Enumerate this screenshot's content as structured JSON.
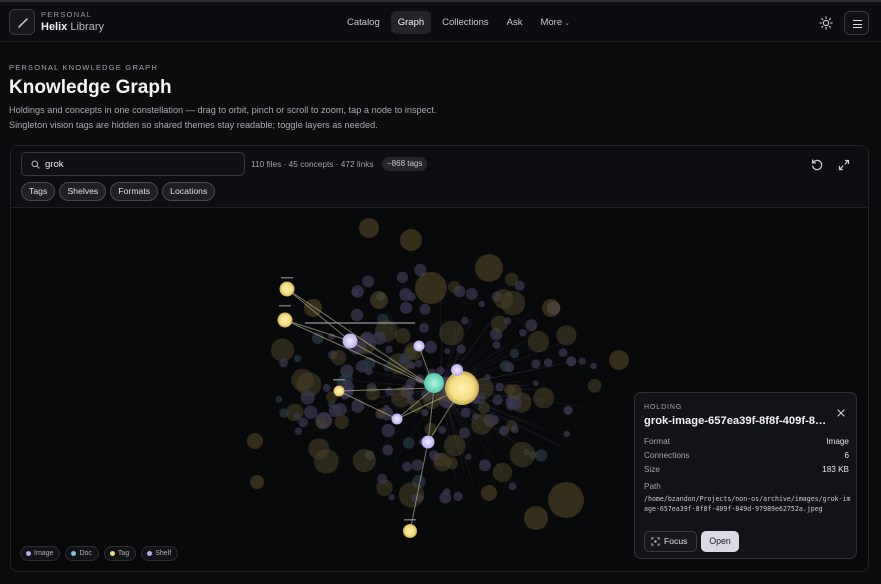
{
  "header": {
    "brand_sup": "PERSONAL",
    "brand_bold": "Helix",
    "brand_rest": " Library",
    "nav": [
      "Catalog",
      "Graph",
      "Collections",
      "Ask",
      "More"
    ],
    "active_nav": "Graph"
  },
  "page": {
    "eyebrow": "PERSONAL KNOWLEDGE GRAPH",
    "title": "Knowledge Graph",
    "desc_line1": "Holdings and concepts in one constellation — drag to orbit, pinch or scroll to zoom, tap a node to inspect.",
    "desc_line2": "Singleton vision tags are hidden so shared themes stay readable; toggle layers as needed."
  },
  "toolbar": {
    "search_value": "grok",
    "stats": "110 files · 45 concepts · 472 links",
    "tag_badge": "−868 tags",
    "chips": [
      "Tags",
      "Shelves",
      "Formats",
      "Locations"
    ]
  },
  "legend": [
    {
      "label": "Image",
      "color": "#b7a8f0"
    },
    {
      "label": "Doc",
      "color": "#7fc6e8"
    },
    {
      "label": "Tag",
      "color": "#f2dc82"
    },
    {
      "label": "Shelf",
      "color": "#b7a8f0"
    }
  ],
  "colors": {
    "image": "#d6cdf7",
    "tag": "#f5e08a",
    "shelf": "#78e0c4",
    "doc": "#7fc6e8",
    "accent_open": "#d9dae3"
  },
  "node_card": {
    "eyebrow": "HOLDING",
    "title": "grok-image-657ea39f-8f8f-409f-849d-97989e62752a.jpeg",
    "format_label": "Format",
    "format_value": "Image",
    "connections_label": "Connections",
    "connections_value": "6",
    "size_label": "Size",
    "size_value": "183 KB",
    "path_label": "Path",
    "path_value": "/home/bzandon/Projects/non-os/archive/images/grok-image-657ea39f-8f8f-409f-849d-97989e62752a.jpeg",
    "focus_label": "Focus",
    "open_label": "Open"
  }
}
